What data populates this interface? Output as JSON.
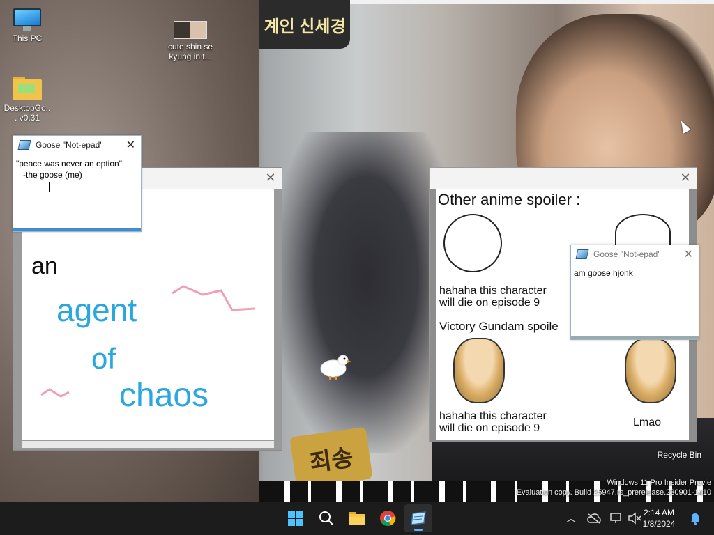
{
  "desktop": {
    "icons": [
      {
        "label": "This PC",
        "icon": "computer-icon"
      },
      {
        "label": "DesktopGo... v0.31",
        "icon": "folder-icon"
      },
      {
        "label": "cute shin se kyung in t...",
        "icon": "image-thumbnail-icon"
      }
    ],
    "wallpaper_caption_top": "계인 신세경",
    "wallpaper_caption_bottom": "죄송",
    "recycle_bin_label": "Recycle Bin",
    "watermark_line1": "Windows 11 Pro Insider Previe",
    "watermark_line2": "Evaluation copy. Build 25947.rs_prerelease.230901-1410"
  },
  "goose_notepad_1": {
    "title": "Goose \"Not-epad\"",
    "text": "\"peace was never an option\"\n   -the goose (me)"
  },
  "goose_notepad_2": {
    "title": "Goose \"Not-epad\"",
    "text": "am goose hjonk"
  },
  "drawing_note": {
    "words": [
      "an",
      "agent",
      "of",
      "chaos"
    ],
    "colors": {
      "black": "#111111",
      "blue": "#2aa7df",
      "pink": "#f0a0b4"
    }
  },
  "meme_note": {
    "title": "Other anime spoiler :",
    "caption_top_left": "hahaha this character\nwill die on episode 9",
    "subtitle": "Victory Gundam spoile",
    "caption_bottom_left": "hahaha this character\nwill die on episode 9",
    "caption_bottom_right": "Lmao"
  },
  "taskbar": {
    "apps": [
      {
        "name": "start",
        "icon": "windows-logo-icon"
      },
      {
        "name": "search",
        "icon": "search-icon"
      },
      {
        "name": "file-explorer",
        "icon": "folder-icon"
      },
      {
        "name": "chrome",
        "icon": "chrome-icon"
      },
      {
        "name": "goose-notepad",
        "icon": "notepad-icon",
        "active": true
      }
    ],
    "time": "2:14 AM",
    "date": "1/8/2024",
    "accent": "#5fb2ff"
  }
}
